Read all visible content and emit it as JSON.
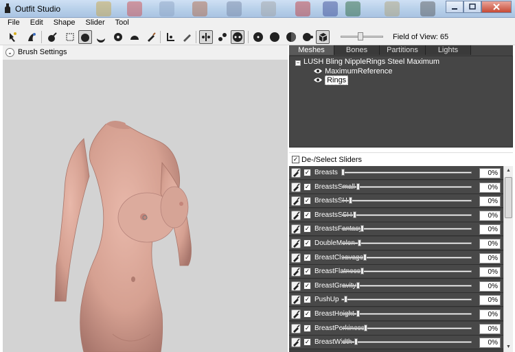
{
  "window": {
    "title": "Outfit Studio"
  },
  "menu": [
    "File",
    "Edit",
    "Shape",
    "Slider",
    "Tool"
  ],
  "toolbar": {
    "fov_label": "Field of View: 65",
    "fov_value": 65
  },
  "brush_settings": {
    "label": "Brush Settings"
  },
  "tabs": [
    {
      "label": "Meshes",
      "selected": true
    },
    {
      "label": "Bones",
      "selected": false
    },
    {
      "label": "Partitions",
      "selected": false
    },
    {
      "label": "Lights",
      "selected": false
    }
  ],
  "tree": {
    "expand_symbol": "−",
    "root": "LUSH Bling NippleRings Steel Maximum",
    "children": [
      "MaximumReference",
      "Rings"
    ],
    "selected": "Rings"
  },
  "sliders_header": {
    "label": "De-/Select Sliders",
    "checked": true
  },
  "sliders": [
    {
      "name": "Breasts",
      "value": "0%",
      "level": 0.0
    },
    {
      "name": "BreastsSmall",
      "value": "0%",
      "level": 0.12
    },
    {
      "name": "BreastsSH",
      "value": "0%",
      "level": 0.06
    },
    {
      "name": "BreastsSSH",
      "value": "0%",
      "level": 0.09
    },
    {
      "name": "BreastsFantasy",
      "value": "0%",
      "level": 0.15
    },
    {
      "name": "DoubleMelon",
      "value": "0%",
      "level": 0.13
    },
    {
      "name": "BreastCleavage",
      "value": "0%",
      "level": 0.17
    },
    {
      "name": "BreastFlatness",
      "value": "0%",
      "level": 0.15
    },
    {
      "name": "BreastGravity",
      "value": "0%",
      "level": 0.12
    },
    {
      "name": "PushUp",
      "value": "0%",
      "level": 0.02
    },
    {
      "name": "BreastHeight",
      "value": "0%",
      "level": 0.12
    },
    {
      "name": "BreastPerkiness",
      "value": "0%",
      "level": 0.18
    },
    {
      "name": "BreastWidth",
      "value": "0%",
      "level": 0.1
    }
  ],
  "check_glyph": "✓",
  "colors": {
    "viewport": "#d3d3d3",
    "panel_dark": "#464646",
    "skin": "#d9a294"
  }
}
